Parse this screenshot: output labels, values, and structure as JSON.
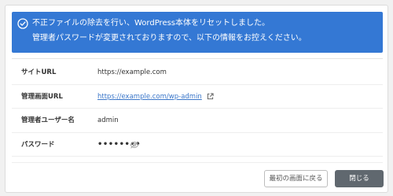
{
  "notice": {
    "line1": "不正ファイルの除去を行い、WordPress本体をリセットしました。",
    "line2": "管理者パスワードが変更されておりますので、以下の情報をお控えください。",
    "icon": "check-circle-icon",
    "bg_color": "#3478d4"
  },
  "rows": [
    {
      "label": "サイトURL",
      "value": "https://example.com"
    },
    {
      "label": "管理画面URL",
      "value": "https://example.com/wp-admin"
    },
    {
      "label": "管理者ユーザー名",
      "value": "admin"
    },
    {
      "label": "パスワード",
      "value": "••••••••"
    }
  ],
  "buttons": {
    "back": "最初の画面に戻る",
    "close": "閉じる"
  },
  "colors": {
    "link": "#3a76c9",
    "close_button": "#60686f"
  }
}
